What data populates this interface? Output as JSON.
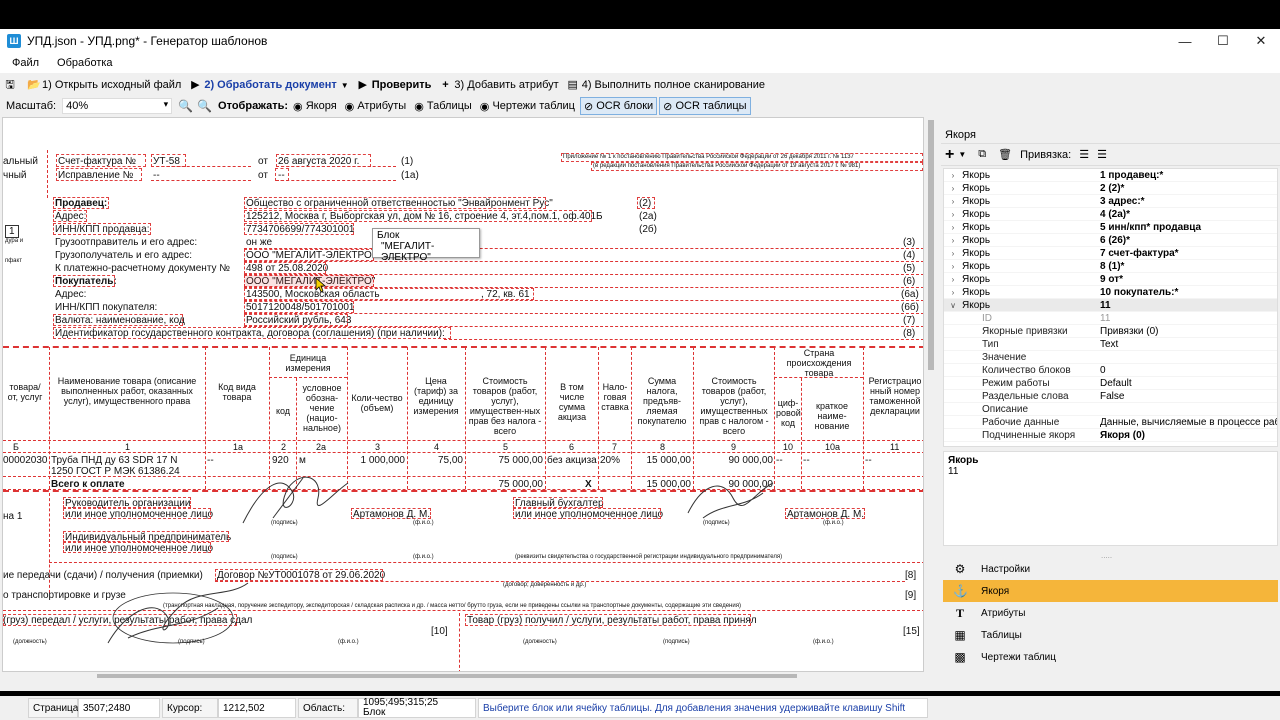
{
  "window": {
    "title": "УПД.json - УПД.png* - Генератор шаблонов",
    "app_icon": "app-icon"
  },
  "menu": [
    "Файл",
    "Обработка"
  ],
  "toolbar": {
    "open": "1) Открыть исходный файл",
    "process": "2) Обработать документ",
    "check": "Проверить",
    "add_attr": "3) Добавить атрибут",
    "full_scan": "4) Выполнить полное сканирование"
  },
  "options": {
    "scale_label": "Масштаб:",
    "scale_value": "40%",
    "show_label": "Отображать:",
    "anchors": "Якоря",
    "attributes": "Атрибуты",
    "tables": "Таблицы",
    "drawings": "Чертежи таблиц",
    "ocr_blocks": "OCR блоки",
    "ocr_tables": "OCR таблицы"
  },
  "doc": {
    "l01": "альный",
    "l02": "чный",
    "invoice": "Счет-фактура №",
    "invoice_no": "УТ-58",
    "from": "от",
    "date": "26 августа 2020 г.",
    "m1": "(1)",
    "fix": "Исправление №",
    "fix_no": "--",
    "fix_from": "от",
    "fix_date": "--",
    "m1a": "(1а)",
    "appendix1": "Приложение № 1 к постановлению Правительства Российской Федерации от 26 декабря 2011 г. № 1137",
    "appendix2": "(в редакции постановления Правительства Российской Федерации от 19 августа 2017 г. № 981)",
    "seller": "Продавец:",
    "seller_val": "Общество с ограниченной ответственностью \"Энвайронмент Рус\"",
    "m2": "(2)",
    "addr": "Адрес:",
    "addr_val": "125212, Москва г, Выборгская ул, дом № 16, строение 4, эт.4,пом.1, оф.401Б",
    "m2a": "(2а)",
    "inn": "ИНН/КПП продавца:",
    "inn_val": "7734706699/774301001",
    "m2b": "(2б)",
    "shipper": "Грузоотправитель и его адрес:",
    "shipper_val": "он же",
    "m3": "(3)",
    "consignee": "Грузополучатель и его адрес:",
    "consignee_val": "ООО \"МЕГАЛИТ-ЭЛЕКТРО\"",
    "m4": "(4)",
    "payment": "К платежно-расчетному документу №",
    "payment_val": "498 от 25.08.2020",
    "m5": "(5)",
    "buyer": "Покупатель:",
    "buyer_val": "ООО \"МЕГАЛИТ-ЭЛЕКТРО\"",
    "m6": "(6)",
    "baddr": "Адрес:",
    "baddr_val": "143500, Московская область",
    "baddr_tail": ", 72, кв. 61",
    "m6a": "(6а)",
    "binn": "ИНН/КПП покупателя:",
    "binn_val": "5017120048/501701001",
    "m6b": "(6б)",
    "currency": "Валюта: наименование, код",
    "currency_val": "Российский рубль, 643",
    "m7": "(7)",
    "gov": "Идентификатор государственного контракта, договора (соглашения) (при наличии):",
    "m8": "(8)",
    "side1": "1",
    "side2": "дура и",
    "side3": "пфакт",
    "h_code_goods": "товара/ от, услуг",
    "h_name": "Наименование товара (описание выполненных работ, оказанных услуг), имущественного права",
    "h_kind": "Код вида товара",
    "h_unit": "Единица измерения",
    "h_unit_code": "код",
    "h_unit_name": "условное обозна-чение (нацио-нальное)",
    "h_qty": "Коли-чество (объем)",
    "h_price": "Цена (тариф) за единицу измерения",
    "h_cost": "Стоимость товаров (работ, услуг), имуществен-ных прав без налога - всего",
    "h_excise": "В том числе сумма акциза",
    "h_rate": "Нало-говая ставка",
    "h_tax": "Сумма налога, предъяв-ляемая покупателю",
    "h_total": "Стоимость товаров (работ, услуг), имущественных прав с налогом - всего",
    "h_country": "Страна происхождения товара",
    "h_country_code": "циф-ровой код",
    "h_country_name": "краткое наиме-нование",
    "h_reg": "Регистрацио нный номер таможенной декларации",
    "n_b": "Б",
    "n_1": "1",
    "n_1a": "1а",
    "n_2": "2",
    "n_2a": "2а",
    "n_3": "3",
    "n_4": "4",
    "n_5": "5",
    "n_6": "6",
    "n_7": "7",
    "n_8": "8",
    "n_9": "9",
    "n_10": "10",
    "n_10a": "10а",
    "n_11": "11",
    "r_code": "00002030",
    "r_name": "Труба ПНД ду 63 SDR 17 N 1250 ГОСТ Р МЭК 61386.24",
    "r_kind": "--",
    "r_ucode": "920",
    "r_uname": "м",
    "r_qty": "1 000,000",
    "r_price": "75,00",
    "r_cost": "75 000,00",
    "r_excise": "без акциза",
    "r_rate": "20%",
    "r_tax": "15 000,00",
    "r_total": "90 000,00",
    "r_cc": "--",
    "r_cn": "--",
    "r_reg": "--",
    "total_label": "Всего к оплате",
    "total_cost": "75 000,00",
    "total_x": "X",
    "total_tax": "15 000,00",
    "total_sum": "90 000,00",
    "left_ha": "на 1",
    "head": "Руководитель организации",
    "head2": "или иное уполномоченное лицо",
    "sign": "(подпись)",
    "head_name": "Артамонов Д. М.",
    "fio": "(ф.и.о.)",
    "chief": "Главный бухгалтер",
    "chief2": "или иное уполномоченное лицо",
    "chief_name": "Артамонов Д. М.",
    "ip": "Индивидуальный предприниматель",
    "ip2": "или иное уполномоченное лицо",
    "ip_reg": "(реквизиты свидетельства о государственной  регистрации индивидуального предпринимателя)",
    "transfer": "ие передачи (сдачи) / получения (приемки)",
    "contract": "Договор №УТ0001078 от 29.06.2020",
    "m8b": "[8]",
    "contract_sub": "(договор; доверенность и др.)",
    "transport": "о транспортировке и грузе",
    "m9": "[9]",
    "transport_sub": "(транспортная накладная, поручение экспедитору, экспедиторская / складская расписка и др. / масса нетто/ брутто груза, если не приведены ссылки на транспортные документы, содержащие эти сведения)",
    "passed": "(груз) передал / услуги, результаты работ, права сдал",
    "m10": "[10]",
    "received": "Товар (груз) получил / услуги, результаты работ, права принял",
    "m15": "[15]",
    "dolzh": "(должность)",
    "podp": "(подпись)",
    "fio2": "(ф.и.о.)"
  },
  "tooltip": {
    "title": "Блок",
    "text": "\"МЕГАЛИТ-ЭЛЕКТРО\""
  },
  "status": {
    "page_label": "Страница:",
    "page_val": "3507;2480",
    "cursor_label": "Курсор:",
    "cursor_val": "1212,502",
    "area_label": "Область:",
    "area_val": "1095;495;315;25",
    "area_sub": "Блок",
    "hint": "Выберите блок или ячейку таблицы. Для добавления значения удерживайте клавишу Shift"
  },
  "panel": {
    "title": "Якоря",
    "binding_label": "Привязка:",
    "anchors": [
      {
        "k": "Якорь",
        "v": "1 продавец:*"
      },
      {
        "k": "Якорь",
        "v": "2 (2)*"
      },
      {
        "k": "Якорь",
        "v": "3 адрес:*"
      },
      {
        "k": "Якорь",
        "v": "4 (2а)*"
      },
      {
        "k": "Якорь",
        "v": "5 инн/кпп* продавца"
      },
      {
        "k": "Якорь",
        "v": "6 (26)*"
      },
      {
        "k": "Якорь",
        "v": "7 счет-фактура*"
      },
      {
        "k": "Якорь",
        "v": "8 (1)*"
      },
      {
        "k": "Якорь",
        "v": "9 от*"
      },
      {
        "k": "Якорь",
        "v": "10 покупатель:*"
      },
      {
        "k": "Якорь",
        "v": "11"
      }
    ],
    "props": [
      {
        "k": "ID",
        "v": "11"
      },
      {
        "k": "Якорные привязки",
        "v": "Привязки (0)"
      },
      {
        "k": "Тип",
        "v": "Text"
      },
      {
        "k": "Значение",
        "v": ""
      },
      {
        "k": "Количество блоков",
        "v": "0"
      },
      {
        "k": "Режим работы",
        "v": "Default"
      },
      {
        "k": "Раздельные слова",
        "v": "False"
      },
      {
        "k": "Описание",
        "v": ""
      },
      {
        "k": "Рабочие данные",
        "v": "Данные, вычисляемые в процессе работы"
      },
      {
        "k": "Подчиненные якоря",
        "v": "Якоря (0)"
      }
    ],
    "desc_title": "Якорь",
    "desc_val": "11",
    "nav": [
      {
        "label": "Настройки",
        "icon": "gear-icon"
      },
      {
        "label": "Якоря",
        "icon": "anchor-icon"
      },
      {
        "label": "Атрибуты",
        "icon": "text-icon"
      },
      {
        "label": "Таблицы",
        "icon": "table-icon"
      },
      {
        "label": "Чертежи таблиц",
        "icon": "grid-icon"
      }
    ]
  },
  "colors": {
    "accent": "#f5b53a",
    "ocr_box": "#e04040",
    "hint_text": "#1a3fa8"
  }
}
